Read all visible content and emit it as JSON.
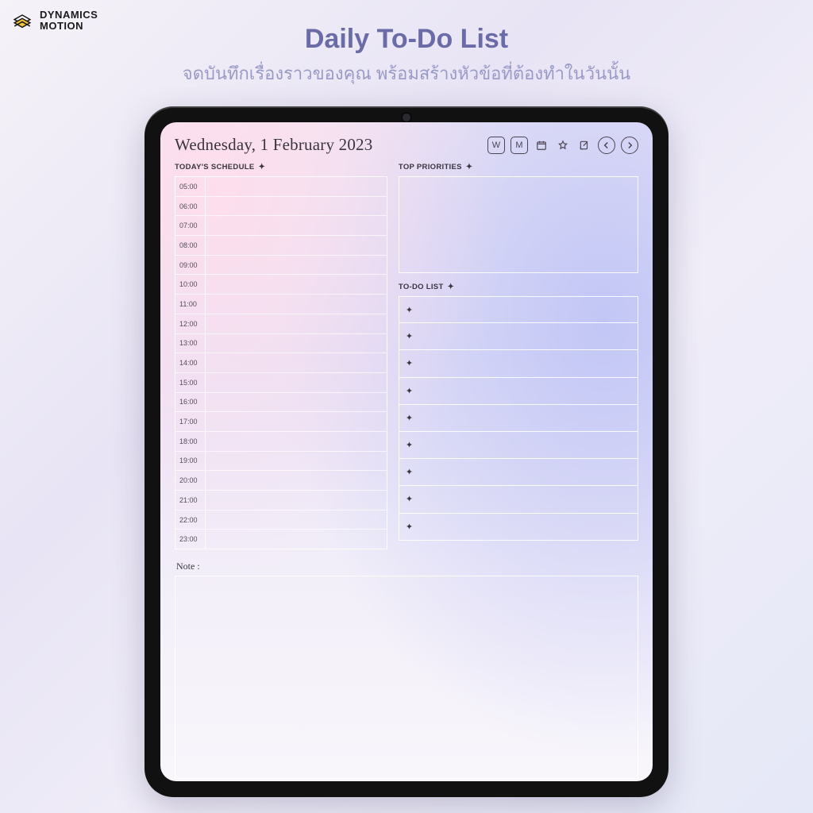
{
  "brand": {
    "line1": "DYNAMICS",
    "line2": "MOTION"
  },
  "headline": {
    "title": "Daily To-Do List",
    "subtitle": "จดบันทึกเรื่องราวของคุณ พร้อมสร้างหัวข้อที่ต้องทำในวันนั้น"
  },
  "planner": {
    "date": "Wednesday, 1 February 2023",
    "toolbar": {
      "week": "W",
      "month": "M"
    },
    "sections": {
      "schedule": "TODAY'S SCHEDULE",
      "priorities": "TOP PRIORITIES",
      "todo": "TO-DO LIST",
      "note": "Note :"
    },
    "hours": [
      "05:00",
      "06:00",
      "07:00",
      "08:00",
      "09:00",
      "10:00",
      "11:00",
      "12:00",
      "13:00",
      "14:00",
      "15:00",
      "16:00",
      "17:00",
      "18:00",
      "19:00",
      "20:00",
      "21:00",
      "22:00",
      "23:00"
    ],
    "todo_count": 9
  }
}
